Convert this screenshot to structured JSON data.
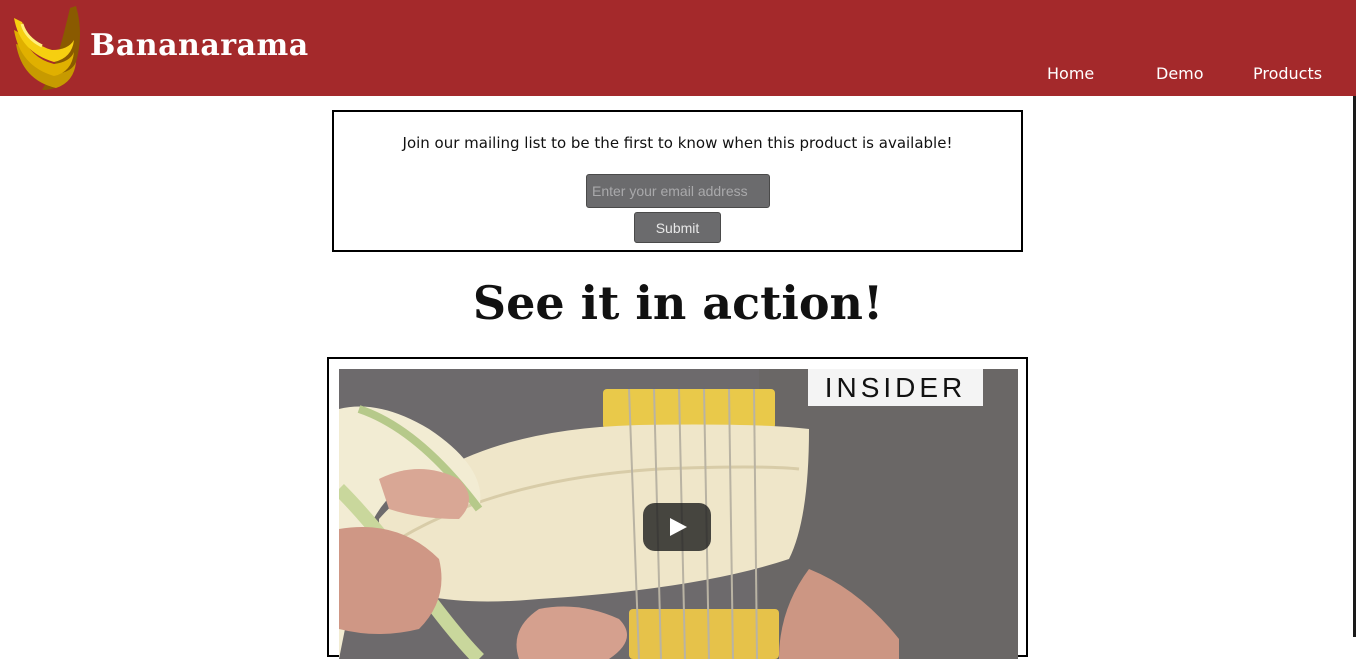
{
  "header": {
    "brand": "Bananarama",
    "brand_color": "#a4292b",
    "logo_icon": "banana-bunch-icon",
    "nav": [
      {
        "label": "Home"
      },
      {
        "label": "Demo"
      },
      {
        "label": "Products"
      }
    ]
  },
  "mailing_list": {
    "prompt": "Join our mailing list to be the first to know when this product is available!",
    "email_placeholder": "Enter your email address",
    "email_value": "",
    "submit_label": "Submit"
  },
  "demo": {
    "title": "See it in action!",
    "video_badge": "INSIDER",
    "play_icon": "play-icon"
  }
}
